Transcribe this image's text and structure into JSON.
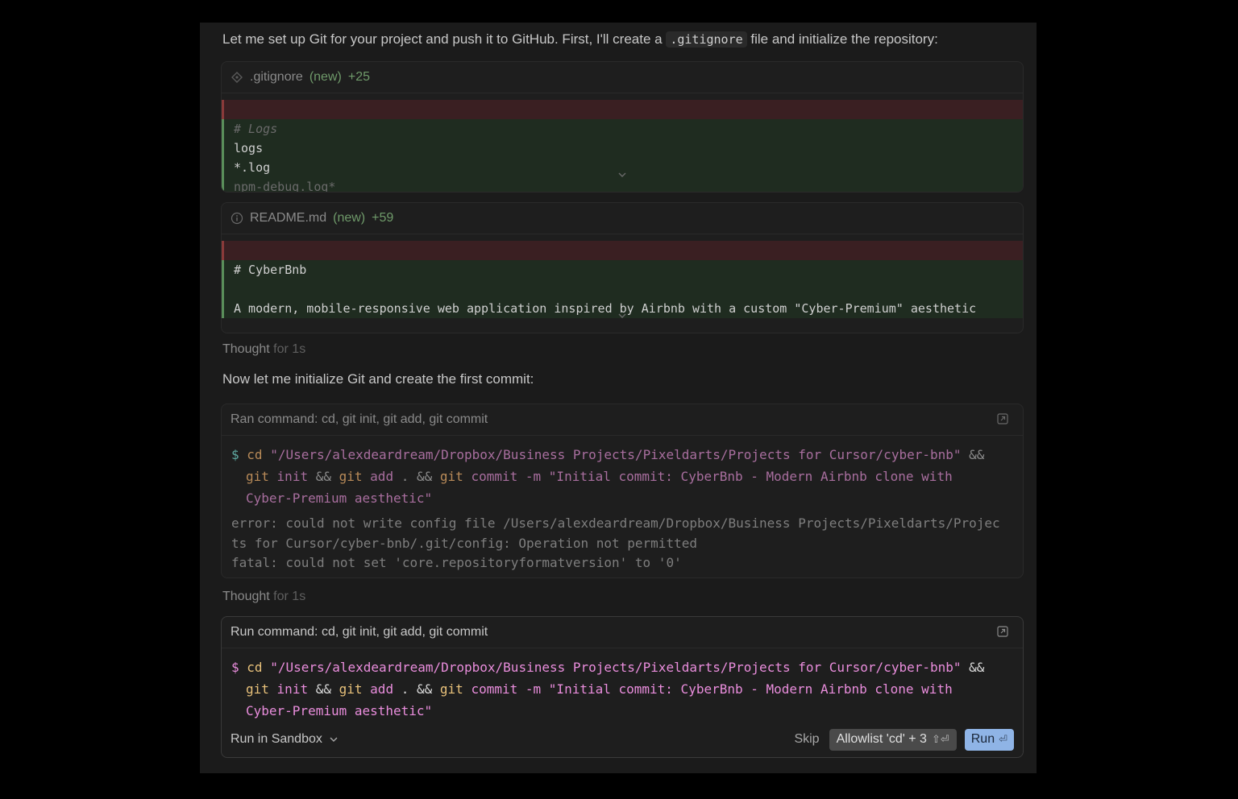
{
  "intro": {
    "before": "Let me set up Git for your project and push it to GitHub. First, I'll create a ",
    "code": ".gitignore",
    "after": " file and initialize the repository:"
  },
  "gitignore_card": {
    "filename": ".gitignore",
    "status": "(new)",
    "additions": "+25",
    "icon": "git-diamond-icon",
    "lines": [
      "# Logs",
      "logs",
      "*.log",
      "npm-debug.log*"
    ]
  },
  "readme_card": {
    "filename": "README.md",
    "status": "(new)",
    "additions": "+59",
    "icon": "info-icon",
    "lines": [
      "# CyberBnb",
      "",
      "A modern, mobile-responsive web application inspired by Airbnb with a custom \"Cyber-Premium\" aesthetic"
    ]
  },
  "thought1": {
    "label": "Thought",
    "duration": "for 1s"
  },
  "message2": "Now let me initialize Git and create the first commit:",
  "ran_command": {
    "title": "Ran command: cd, git init, git add, git commit",
    "prompt": "$",
    "cd": "cd",
    "path": "\"/Users/alexdeardream/Dropbox/Business Projects/Pixeldarts/Projects for Cursor/cyber-bnb\"",
    "and": "&&",
    "git": "git",
    "init": "init",
    "add": "add",
    "dot": ".",
    "commit": "commit",
    "flag": "-m",
    "msg1": "\"Initial commit: CyberBnb - Modern Airbnb clone with",
    "msg2": "Cyber-Premium aesthetic\"",
    "error_lines": [
      "error: could not write config file /Users/alexdeardream/Dropbox/Business Projects/Pixeldarts/Projec",
      "ts for Cursor/cyber-bnb/.git/config: Operation not permitted",
      "fatal: could not set 'core.repositoryformatversion' to '0'"
    ]
  },
  "thought2": {
    "label": "Thought",
    "duration": "for 1s"
  },
  "run_command": {
    "title": "Run command: cd, git init, git add, git commit",
    "sandbox_label": "Run in Sandbox",
    "skip_label": "Skip",
    "allowlist_label": "Allowlist 'cd' + 3",
    "allowlist_shortcut": "⇧⏎",
    "run_label": "Run",
    "run_shortcut": "⏎"
  },
  "colors": {
    "background": "#000000",
    "panel": "#1b1b1b",
    "run_button": "#8fb4e6",
    "diff_add": "#1f2c20",
    "diff_del": "#3a1f22"
  }
}
